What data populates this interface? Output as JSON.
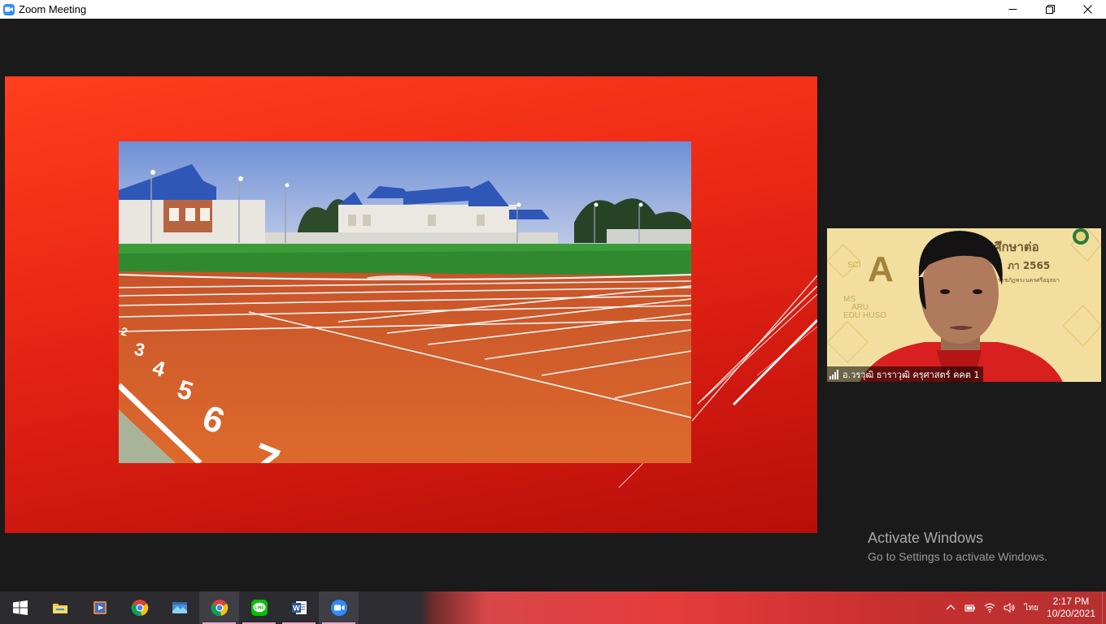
{
  "window": {
    "title": "Zoom Meeting"
  },
  "participant": {
    "name": "อ.วรวุฒิ ธาราวุฒิ ครุศาสตร์ คคต 1",
    "background_text": [
      "A",
      "ศึกษาต่อ",
      "ภา 2565",
      "ราชภัฏพระนครศรีอยุธยา",
      "SCI",
      "MS",
      "ARU",
      "EDU",
      "HUSO"
    ]
  },
  "watermark": {
    "title": "Activate Windows",
    "subtitle": "Go to Settings to activate Windows."
  },
  "taskbar": {
    "apps": [
      "start-icon",
      "file-explorer-icon",
      "media-player-icon",
      "chrome-icon",
      "photos-icon",
      "chrome-icon",
      "line-icon",
      "word-icon",
      "zoom-icon"
    ],
    "language": "ไทย",
    "time": "2:17 PM",
    "date": "10/20/2021"
  },
  "colors": {
    "slide_top": "#ff3f1e",
    "slide_bottom": "#b70e0a",
    "zoom_blue": "#2d8cff",
    "track": "#d9642a",
    "field": "#2f8a2f"
  }
}
